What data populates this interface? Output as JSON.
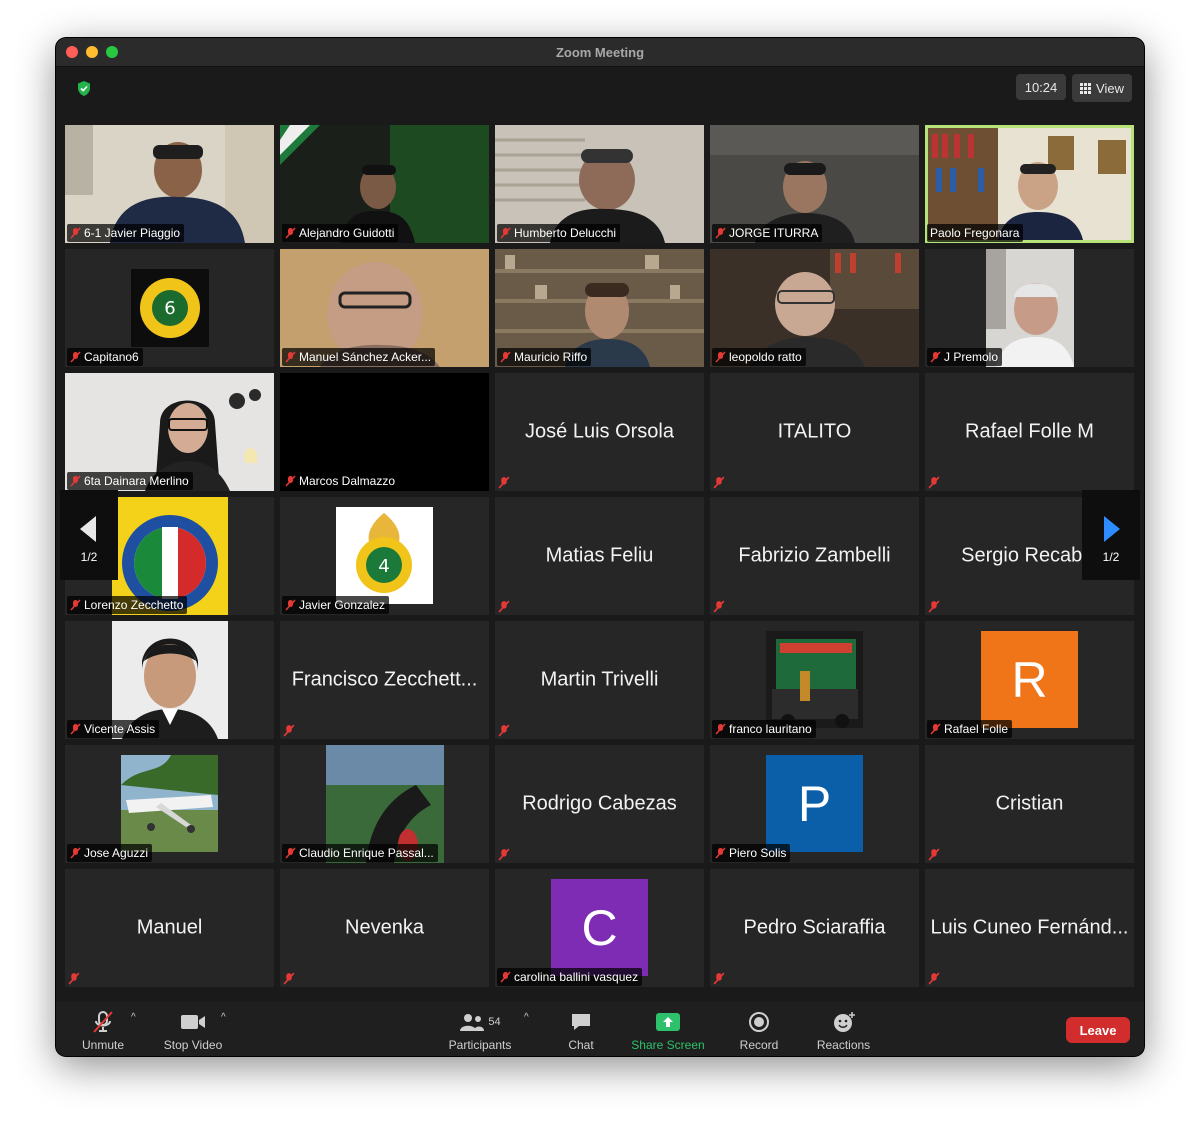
{
  "window": {
    "title": "Zoom Meeting"
  },
  "header": {
    "time": "10:24",
    "view_label": "View"
  },
  "pagination": {
    "left_label": "1/2",
    "right_label": "1/2"
  },
  "tiles": [
    "6-1 Javier Piaggio",
    "Alejandro Guidotti",
    "Humberto Delucchi",
    "JORGE ITURRA",
    "Paolo Fregonara",
    "Capitano6",
    "Manuel Sánchez Acker...",
    "Mauricio Riffo",
    "leopoldo ratto",
    "J Premolo",
    "6ta Dainara Merlino",
    "Marcos Dalmazzo",
    "José Luis Orsola",
    "ITALITO",
    "Rafael Folle M",
    "Lorenzo Zecchetto",
    "Javier Gonzalez",
    "Matias Feliu",
    "Fabrizio Zambelli",
    "Sergio Recabal",
    "Vicente Assis",
    "Francisco Zecchett...",
    "Martin Trivelli",
    "franco lauritano",
    "Rafael Folle",
    "Jose Aguzzi",
    "Claudio Enrique Passal...",
    "Rodrigo Cabezas",
    "Piero Solis",
    "Cristian",
    "Manuel",
    "Nevenka",
    "carolina ballini vasquez",
    "Pedro Sciaraffia",
    "Luis Cuneo Fernánd..."
  ],
  "avatars": {
    "rafael_folle": "R",
    "piero_solis": "P",
    "carolina": "C"
  },
  "toolbar": {
    "unmute": "Unmute",
    "stop_video": "Stop Video",
    "participants": "Participants",
    "participants_count": "54",
    "chat": "Chat",
    "share_screen": "Share Screen",
    "record": "Record",
    "reactions": "Reactions",
    "leave": "Leave"
  },
  "colors": {
    "active_speaker": "#b7e27a",
    "share_green": "#2ec16b",
    "leave_red": "#d12d2d",
    "avatar_orange": "#f07418",
    "avatar_blue": "#0b5fa8",
    "avatar_purple": "#7f2cb5"
  }
}
